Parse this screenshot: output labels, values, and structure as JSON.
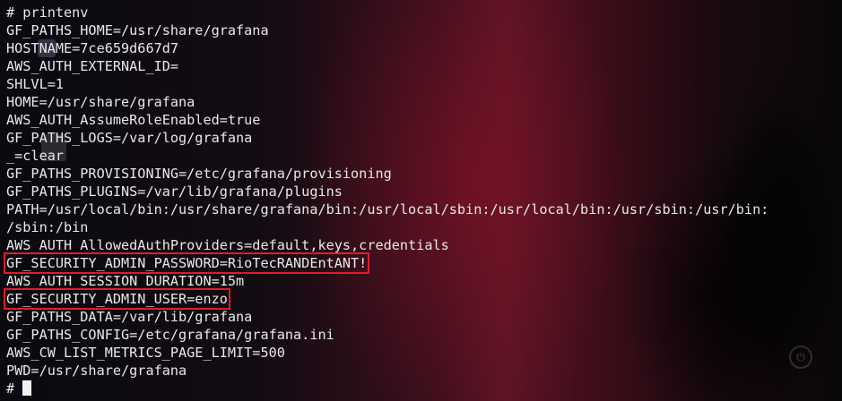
{
  "terminal": {
    "command_line": "# printenv",
    "lines": [
      "GF_PATHS_HOME=/usr/share/grafana",
      "HOSTNAME=7ce659d667d7",
      "AWS_AUTH_EXTERNAL_ID=",
      "SHLVL=1",
      "HOME=/usr/share/grafana",
      "AWS_AUTH_AssumeRoleEnabled=true",
      "GF_PATHS_LOGS=/var/log/grafana",
      "_=clear",
      "GF_PATHS_PROVISIONING=/etc/grafana/provisioning",
      "GF_PATHS_PLUGINS=/var/lib/grafana/plugins",
      "PATH=/usr/local/bin:/usr/share/grafana/bin:/usr/local/sbin:/usr/local/bin:/usr/sbin:/usr/bin:",
      "/sbin:/bin",
      "AWS_AUTH_AllowedAuthProviders=default,keys,credentials",
      "GF_SECURITY_ADMIN_PASSWORD=RioTecRANDEntANT!",
      "AWS_AUTH_SESSION_DURATION=15m",
      "GF_SECURITY_ADMIN_USER=enzo",
      "GF_PATHS_DATA=/var/lib/grafana",
      "GF_PATHS_CONFIG=/etc/grafana/grafana.ini",
      "AWS_CW_LIST_METRICS_PAGE_LIMIT=500",
      "PWD=/usr/share/grafana"
    ],
    "highlighted_line_indices": [
      13,
      15
    ],
    "prompt": "#"
  },
  "colors": {
    "text": "#e8e8e8",
    "highlight_border": "#e21c2a",
    "background_accent": "#5a1424"
  }
}
